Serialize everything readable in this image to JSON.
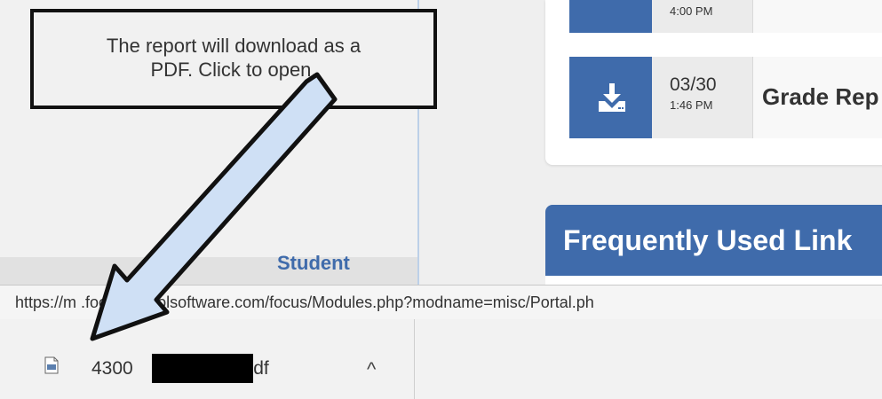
{
  "callout": {
    "line1": "The report will download as a",
    "line2": "PDF.  Click to open."
  },
  "downloads": [
    {
      "date": "03/30",
      "time": "1:46 PM",
      "title": "Grade Rep"
    }
  ],
  "partial_row_time": "4:00 PM",
  "frequently_used": {
    "title": "Frequently Used Link"
  },
  "left_footer_text": "Student",
  "status_bar": {
    "url": "https://m          .focusschoolsoftware.com/focus/Modules.php?modname=misc/Portal.ph"
  },
  "download_shelf": {
    "file_prefix": "4300",
    "file_suffix": ".pdf",
    "chevron": "^"
  },
  "colors": {
    "accent": "#3f6bab",
    "arrow_fill": "#cfe0f5"
  },
  "icons": {
    "download": "download-icon",
    "file": "pdf-file-icon",
    "chevron": "chevron-up-icon"
  }
}
